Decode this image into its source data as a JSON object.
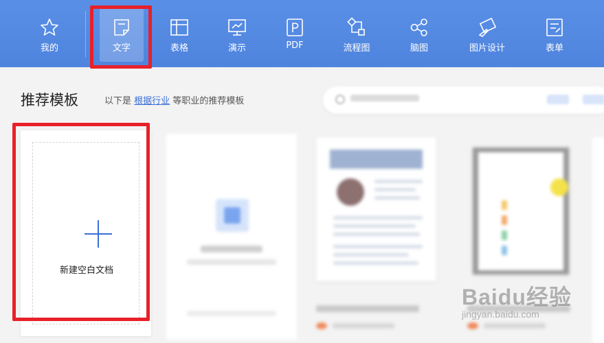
{
  "toolbar": {
    "items": [
      {
        "label": "我的",
        "icon": "star-icon"
      },
      {
        "label": "文字",
        "icon": "document-icon",
        "active": true
      },
      {
        "label": "表格",
        "icon": "table-icon"
      },
      {
        "label": "演示",
        "icon": "presentation-icon"
      },
      {
        "label": "PDF",
        "icon": "pdf-icon"
      },
      {
        "label": "流程图",
        "icon": "flowchart-icon"
      },
      {
        "label": "脑图",
        "icon": "mindmap-icon"
      },
      {
        "label": "图片设计",
        "icon": "image-design-icon"
      },
      {
        "label": "表单",
        "icon": "form-icon"
      }
    ],
    "bg_color": "#5289e2"
  },
  "section": {
    "title": "推荐模板",
    "subtitle_prefix": "以下是",
    "subtitle_link": "根据行业",
    "subtitle_suffix": "等职业的推荐模板"
  },
  "blank_card": {
    "label": "新建空白文档"
  },
  "watermark": {
    "brand": "Baidu经验",
    "url": "jingyan.baidu.com"
  },
  "colors": {
    "accent": "#3a6fd8",
    "highlight_box": "#e8202a"
  }
}
